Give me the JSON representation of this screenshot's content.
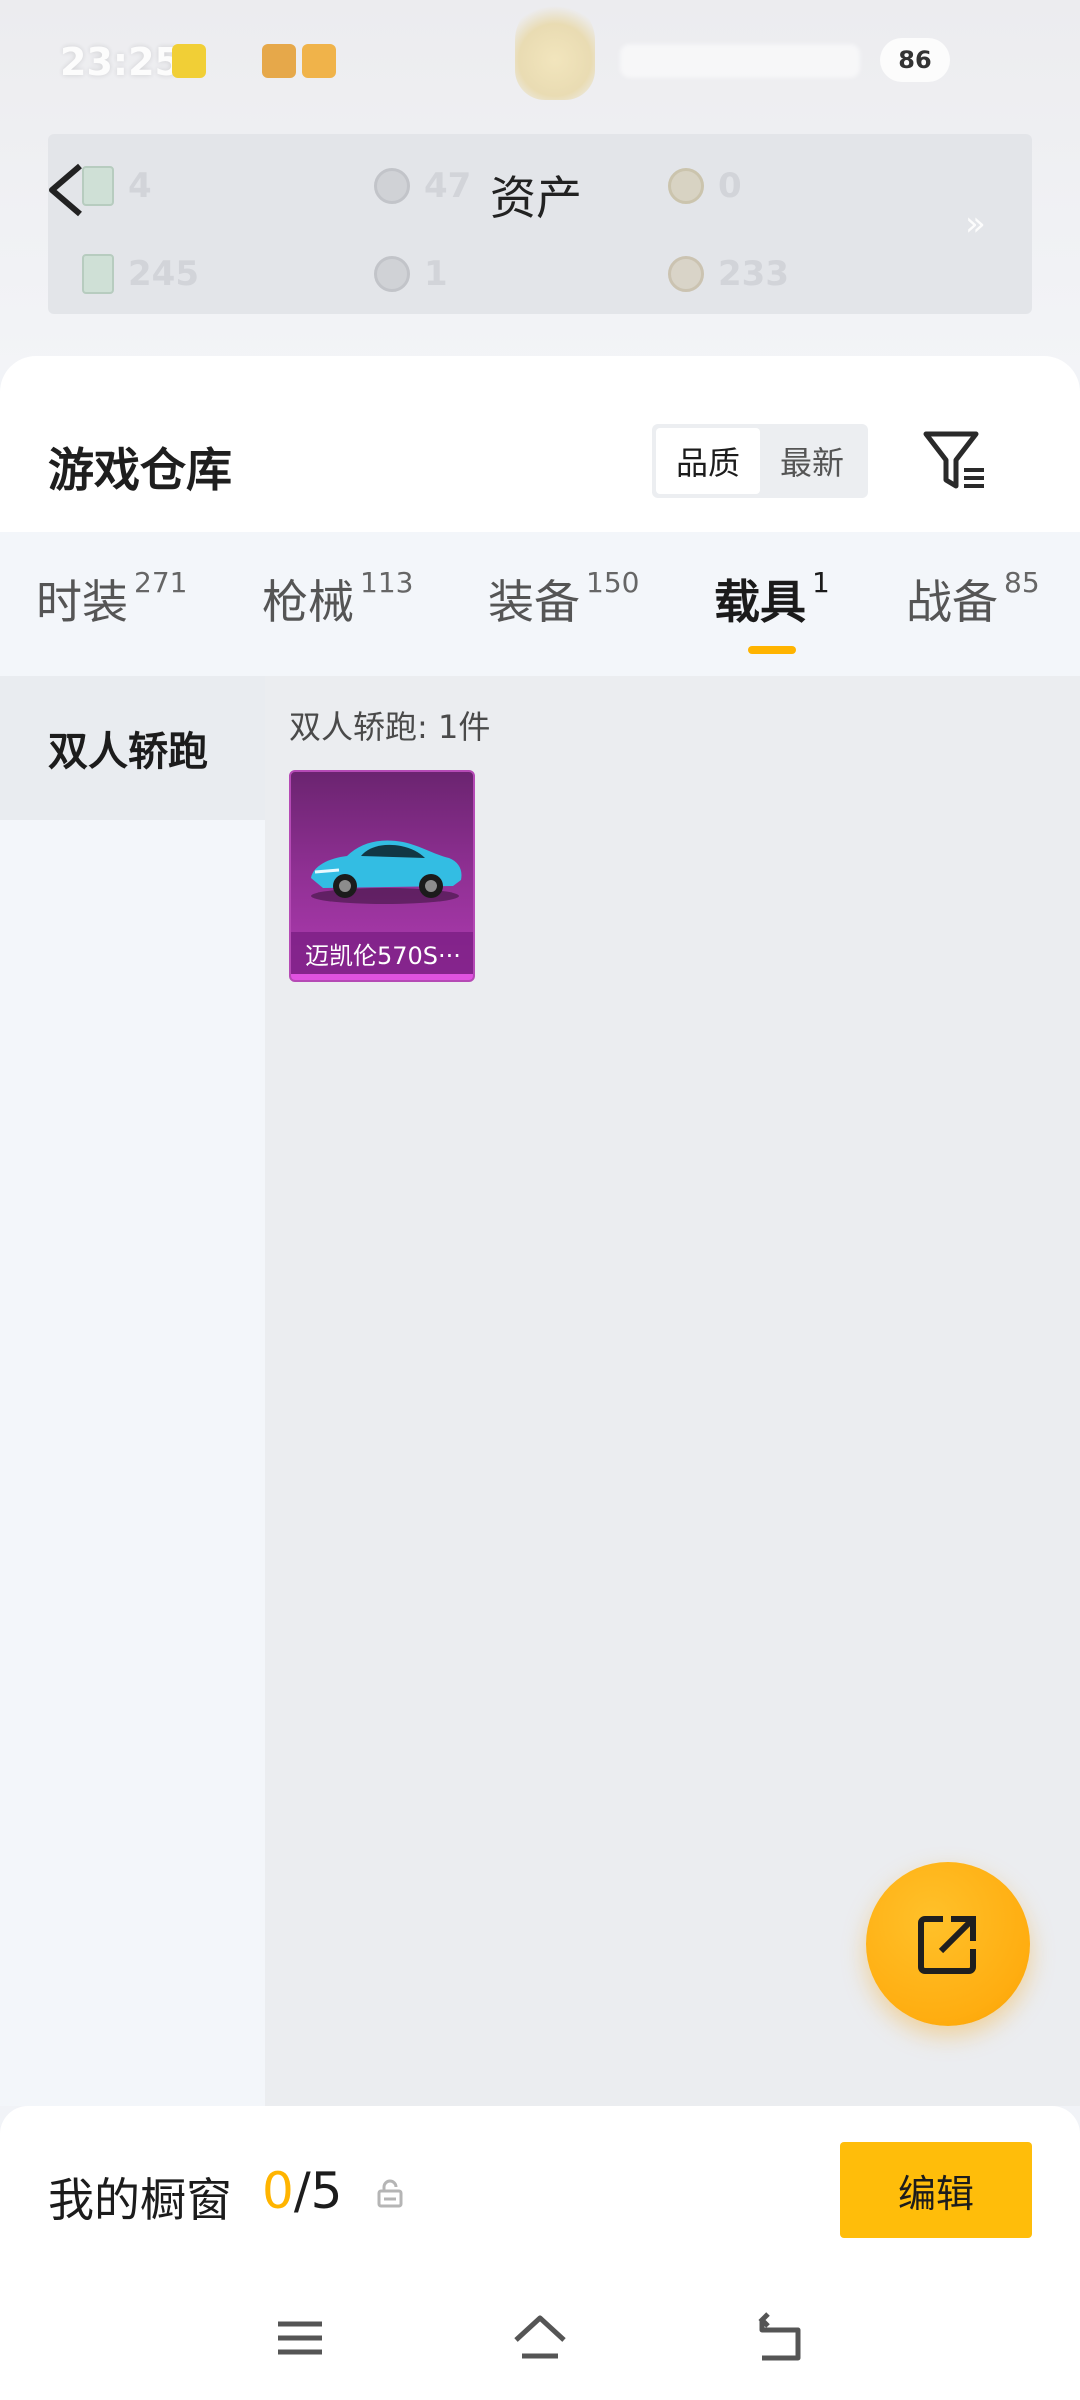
{
  "status_bar": {
    "time": "23:25",
    "battery": "86"
  },
  "assets": {
    "title": "资产",
    "items": [
      {
        "value": "4"
      },
      {
        "value": "47"
      },
      {
        "value": "0"
      },
      {
        "value": "245"
      },
      {
        "value": "1"
      },
      {
        "value": "233"
      }
    ],
    "more": "»"
  },
  "warehouse": {
    "title": "游戏仓库",
    "sort_options": [
      "品质",
      "最新"
    ],
    "active_sort": "品质"
  },
  "tabs": [
    {
      "label": "时装",
      "count": "271"
    },
    {
      "label": "枪械",
      "count": "113"
    },
    {
      "label": "装备",
      "count": "150"
    },
    {
      "label": "载具",
      "count": "1",
      "active": true
    },
    {
      "label": "战备",
      "count": "85"
    }
  ],
  "sidebar": {
    "items": [
      {
        "label": "双人轿跑",
        "active": true
      }
    ]
  },
  "content": {
    "category_count": "双人轿跑: 1件",
    "items": [
      {
        "name": "迈凯伦570S···",
        "rarity_color": "#b03bb2",
        "car_color": "#2fb9df"
      }
    ]
  },
  "showcase": {
    "label": "我的橱窗",
    "current": "0",
    "total": "/5",
    "edit_label": "编辑"
  },
  "colors": {
    "accent": "#ffb400",
    "fab": "#ffad10"
  },
  "icons": {
    "back": "back-arrow-icon",
    "filter": "filter-icon",
    "share": "share-icon",
    "lock": "lock-icon",
    "menu": "menu-icon",
    "home": "home-icon",
    "return": "return-icon"
  }
}
